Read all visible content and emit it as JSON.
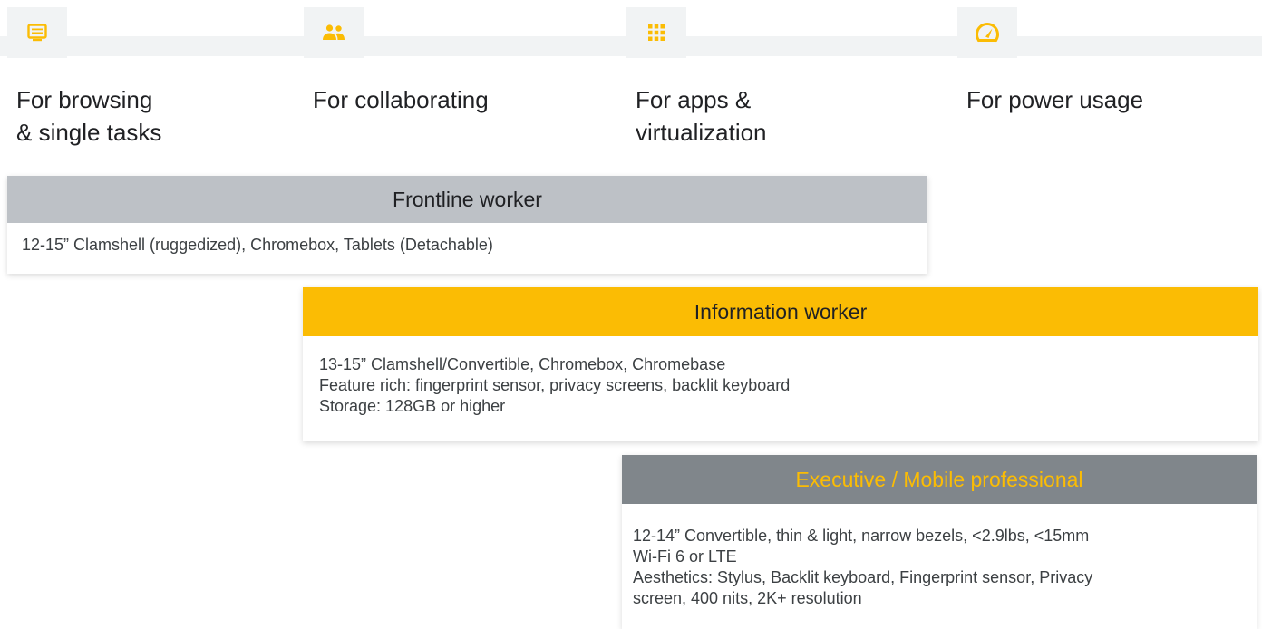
{
  "columns": [
    {
      "icon": "monitor-icon",
      "label": "For browsing\n& single tasks"
    },
    {
      "icon": "people-icon",
      "label": "For collaborating"
    },
    {
      "icon": "apps-grid-icon",
      "label": "For apps &\nvirtualization"
    },
    {
      "icon": "speedometer-icon",
      "label": "For power usage"
    }
  ],
  "personas": [
    {
      "title": "Frontline worker",
      "details": "12-15” Clamshell (ruggedized), Chromebox, Tablets (Detachable)"
    },
    {
      "title": "Information worker",
      "details": "13-15” Clamshell/Convertible, Chromebox, Chromebase\nFeature rich: fingerprint sensor, privacy screens, backlit keyboard\nStorage: 128GB or higher"
    },
    {
      "title": "Executive / Mobile professional",
      "details": "12-14” Convertible, thin & light, narrow bezels, <2.9lbs, <15mm\nWi-Fi 6 or LTE\nAesthetics: Stylus, Backlit keyboard, Fingerprint sensor, Privacy\nscreen, 400 nits, 2K+  resolution"
    }
  ],
  "colors": {
    "accent_yellow": "#fbbc04",
    "grey_light": "#bdc1c6",
    "grey_dark": "#80868b",
    "icon_strip": "#f1f3f4"
  }
}
